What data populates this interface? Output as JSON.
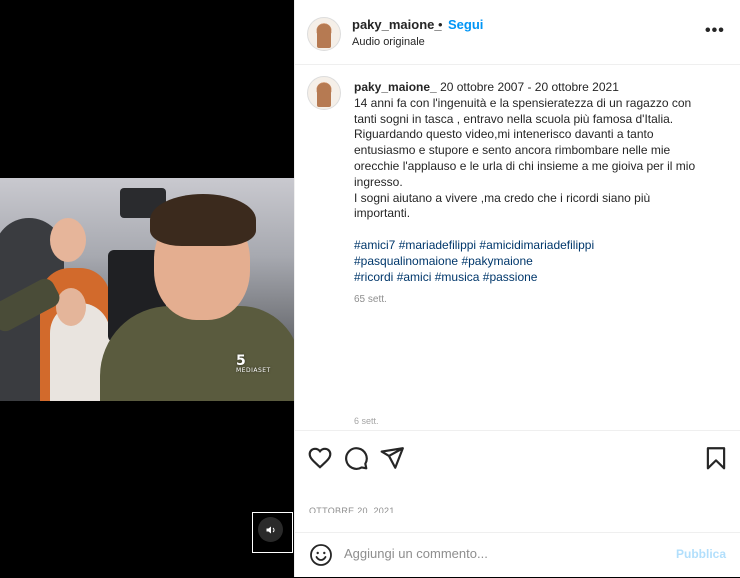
{
  "post": {
    "username": "paky_maione_",
    "separator": "•",
    "follow_label": "Segui",
    "audio_label": "Audio originale",
    "more_label": "•••"
  },
  "caption": {
    "username": "paky_maione_",
    "lines": [
      "20 ottobre 2007 - 20 ottobre 2021",
      "14 anni fa con l'ingenuità e la spensieratezza di un ragazzo con",
      "tanti sogni in tasca , entravo nella scuola più famosa d'Italia.",
      "Riguardando questo video,mi intenerisco davanti a tanto",
      "entusiasmo e stupore e sento ancora rimbombare nelle mie",
      "orecchie l'applauso e le urla di chi insieme a me gioiva per il mio",
      "ingresso.",
      "I sogni aiutano a vivere ,ma credo che i ricordi siano più",
      "importanti."
    ],
    "hashtag_lines": [
      [
        "#amici7",
        "#mariadefilippi",
        "#amicidimariadefilippi"
      ],
      [
        "#pasqualinomaione",
        "#pakymaione"
      ],
      [
        "#ricordi",
        "#amici",
        "#musica",
        "#passione"
      ]
    ],
    "time_ago": "65 sett.",
    "cutoff_text": "6 sett."
  },
  "media": {
    "channel_logo": "5",
    "channel_text": "MEDIASET",
    "audio_icon": "speaker-icon"
  },
  "actions": {
    "like_icon": "heart-icon",
    "comment_icon": "comment-icon",
    "share_icon": "send-icon",
    "save_icon": "bookmark-icon"
  },
  "date": "OTTOBRE 20, 2021",
  "comment": {
    "placeholder": "Aggiungi un commento...",
    "publish_label": "Pubblica"
  },
  "colors": {
    "accent": "#0095f6",
    "publish_disabled": "#b2dffc",
    "hashtag": "#00376b",
    "muted": "#8e8e8e"
  }
}
